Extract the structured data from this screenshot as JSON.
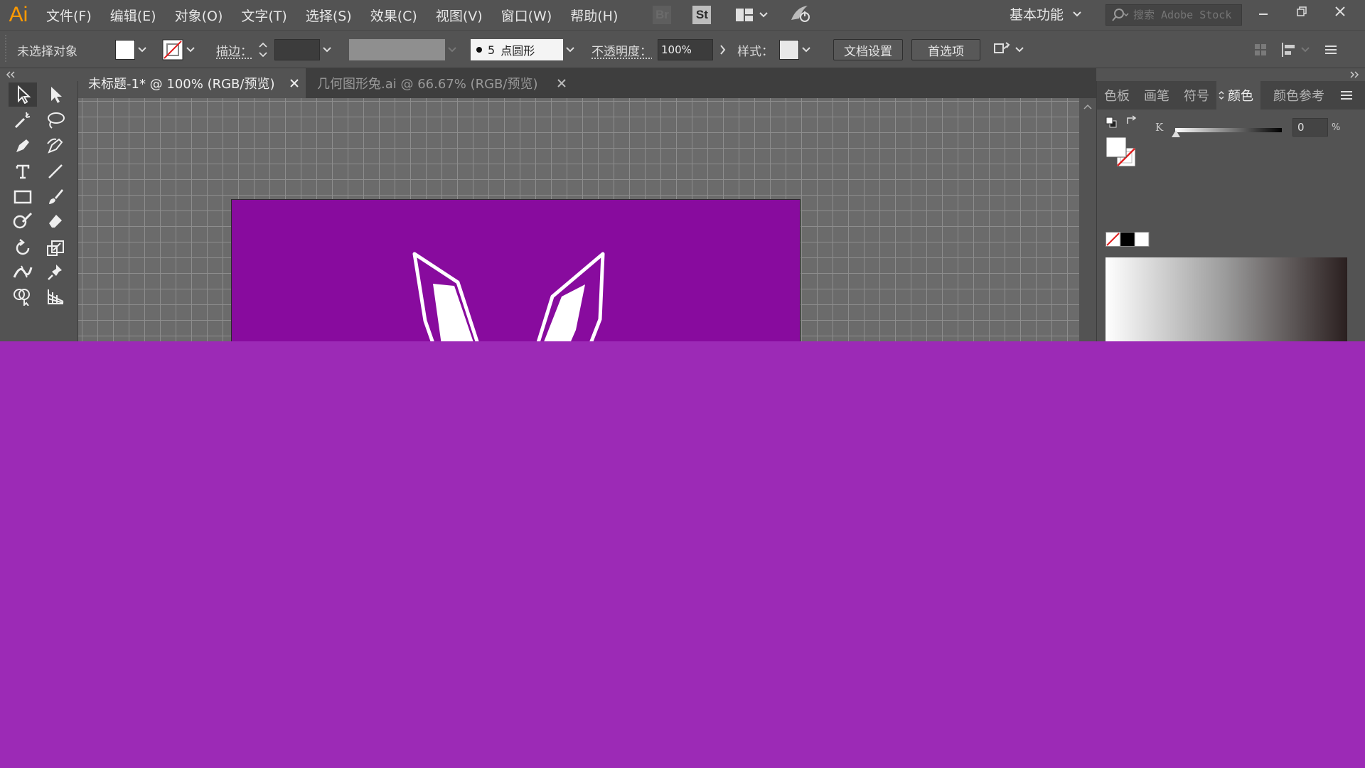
{
  "app": {
    "logo": "Ai"
  },
  "menu": [
    "文件(F)",
    "编辑(E)",
    "对象(O)",
    "文字(T)",
    "选择(S)",
    "效果(C)",
    "视图(V)",
    "窗口(W)",
    "帮助(H)"
  ],
  "menubar": {
    "br_label": "Br",
    "st_label": "St",
    "workspace_label": "基本功能",
    "search_placeholder": "搜索 Adobe Stock"
  },
  "control": {
    "selection_status": "未选择对象",
    "stroke_label": "描边：",
    "brush_size": "5",
    "brush_shape": "点圆形",
    "opacity_label": "不透明度：",
    "opacity_value": "100%",
    "style_label": "样式：",
    "doc_setup_button": "文档设置",
    "preferences_button": "首选项"
  },
  "tabs": [
    {
      "label": "未标题-1* @ 100% (RGB/预览)",
      "active": true
    },
    {
      "label": "几何图形兔.ai @ 66.67% (RGB/预览)",
      "active": false
    }
  ],
  "panel": {
    "tabs": [
      "色板",
      "画笔",
      "符号",
      "颜色",
      "颜色参考"
    ],
    "active_tab": "颜色",
    "k_label": "K",
    "k_value": "0",
    "percent": "%"
  },
  "colors": {
    "artboard": "#880b9e",
    "overlay": "#9c2ab6",
    "accent_logo": "#ff9a00"
  }
}
